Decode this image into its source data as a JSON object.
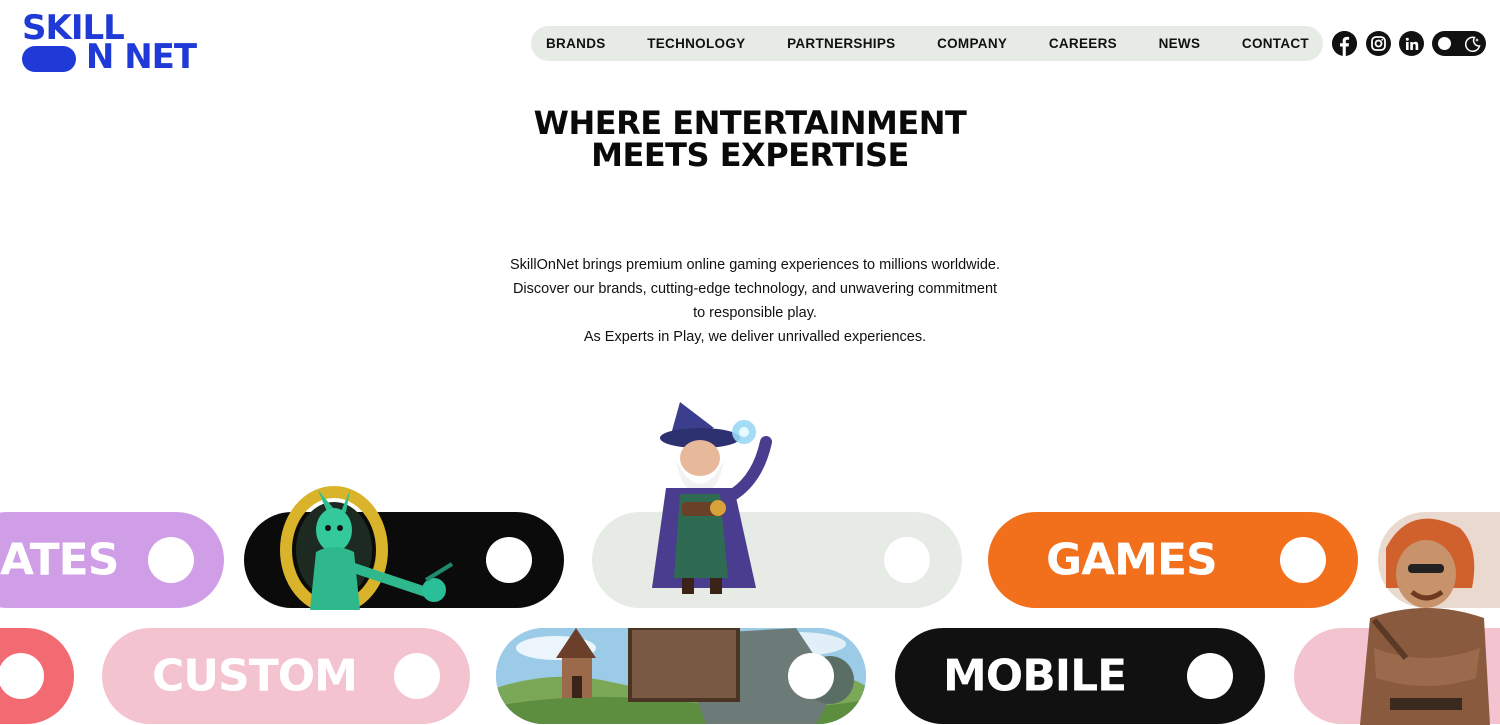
{
  "brand": {
    "logo_line1": "SKILL",
    "logo_line2": "ON NET",
    "color": "#1f3ad6"
  },
  "nav": {
    "items": [
      {
        "label": "BRANDS"
      },
      {
        "label": "TECHNOLOGY"
      },
      {
        "label": "PARTNERSHIPS"
      },
      {
        "label": "COMPANY"
      },
      {
        "label": "CAREERS"
      },
      {
        "label": "NEWS"
      },
      {
        "label": "CONTACT"
      }
    ]
  },
  "social": {
    "icons": [
      "facebook-icon",
      "instagram-icon",
      "linkedin-icon"
    ]
  },
  "theme_toggle": {
    "icon": "moon-icon"
  },
  "hero": {
    "title_line1": "WHERE ENTERTAINMENT",
    "title_line2": "MEETS EXPERTISE",
    "desc_line1": "SkillOnNet brings premium online gaming experiences to millions worldwide.",
    "desc_line2": "Discover our brands, cutting-edge technology, and unwavering commitment",
    "desc_line3": "to responsible play.",
    "desc_line4": "As Experts in Play, we deliver unrivalled experiences."
  },
  "pills": {
    "row1": [
      {
        "label": "ATES",
        "color": "#cf9ee6"
      },
      {
        "label": "",
        "color": "#0b0b0b"
      },
      {
        "label": "",
        "color": "#e6ebe5"
      },
      {
        "label": "GAMES",
        "color": "#f26f1c"
      },
      {
        "label": "",
        "color": "#ededed"
      }
    ],
    "row2": [
      {
        "label": "",
        "color": "#f26a72"
      },
      {
        "label": "CUSTOM",
        "color": "#f3c4d0"
      },
      {
        "label": "",
        "color": "#7fb46a"
      },
      {
        "label": "MOBILE",
        "color": "#111111"
      },
      {
        "label": "",
        "color": "#f3c4d0"
      }
    ]
  }
}
